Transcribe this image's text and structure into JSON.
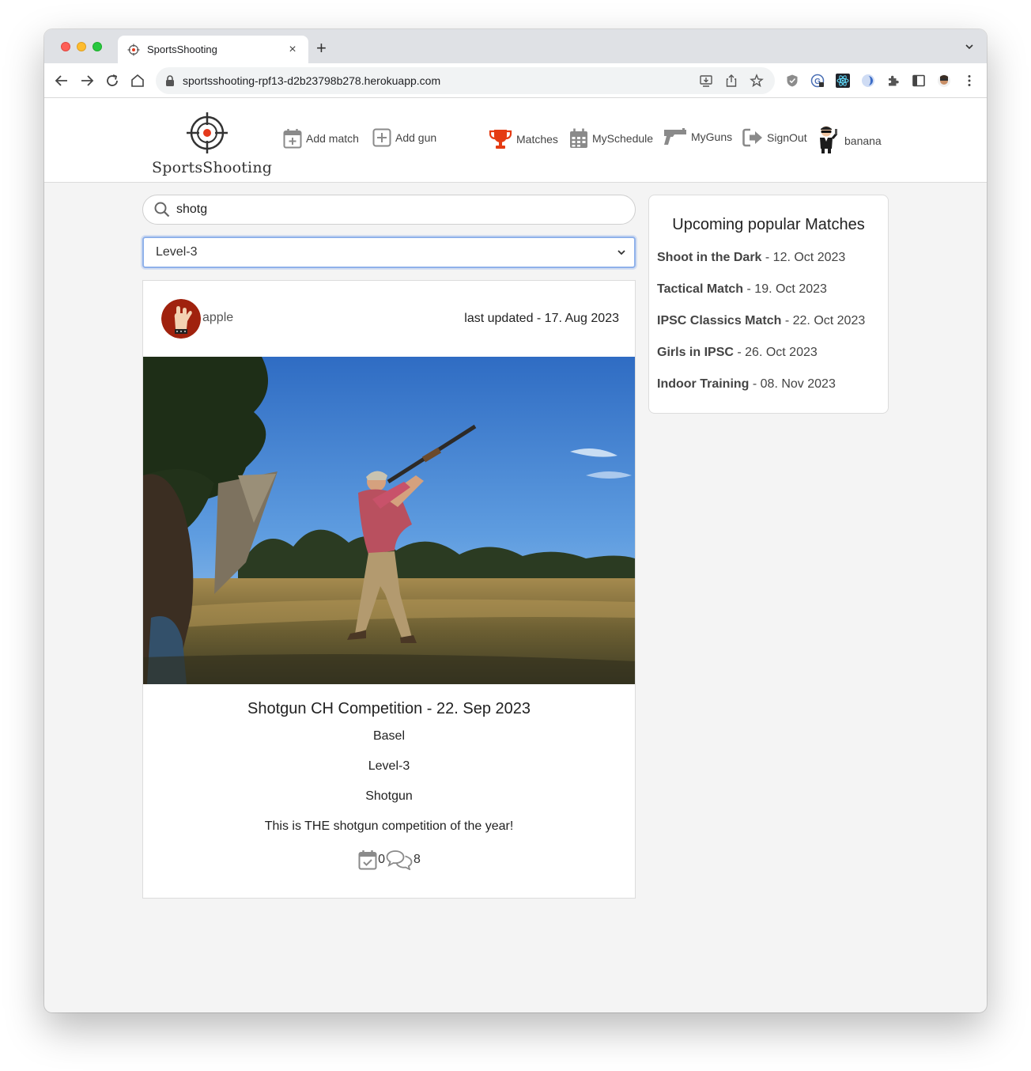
{
  "browser": {
    "tab_title": "SportsShooting",
    "new_tab_label": "+",
    "close_label": "×",
    "url": "sportsshooting-rpf13-d2b23798b278.herokuapp.com"
  },
  "site": {
    "logo_text": "SportsShooting",
    "nav": {
      "add_match": "Add match",
      "add_gun": "Add gun",
      "matches": "Matches",
      "myschedule": "MySchedule",
      "myguns": "MyGuns",
      "signout": "SignOut",
      "user": "banana"
    }
  },
  "search": {
    "value": "shotg"
  },
  "filter": {
    "selected": "Level-3"
  },
  "match_card": {
    "owner": "apple",
    "last_updated": "last updated - 17. Aug 2023",
    "title": "Shotgun CH Competition - 22. Sep 2023",
    "location": "Basel",
    "level": "Level-3",
    "category": "Shotgun",
    "description": "This is THE shotgun competition of the year!",
    "attendees_count": "0",
    "comments_count": "8"
  },
  "sidebar": {
    "title": "Upcoming popular Matches",
    "items": [
      {
        "name": "Shoot in the Dark",
        "date": " - 12. Oct 2023"
      },
      {
        "name": "Tactical Match",
        "date": " - 19. Oct 2023"
      },
      {
        "name": "IPSC Classics Match",
        "date": " - 22. Oct 2023"
      },
      {
        "name": "Girls in IPSC",
        "date": " - 26. Oct 2023"
      },
      {
        "name": "Indoor Training",
        "date": " - 08. Nov 2023"
      }
    ]
  },
  "colors": {
    "trophy": "#e53b12",
    "nav_icon": "#8a8a8a",
    "select_border": "#8fb1ea"
  }
}
